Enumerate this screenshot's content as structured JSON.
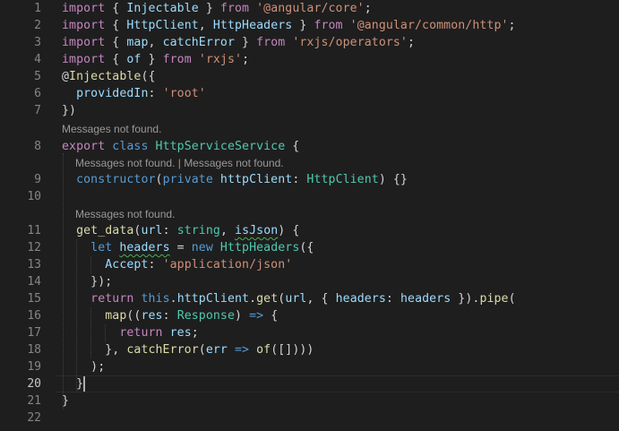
{
  "editor": {
    "codelens_text": "Messages not found.",
    "codelens_pair": "Messages not found. | Messages not found.",
    "lines": [
      {
        "n": "1",
        "seg": [
          [
            "kw2",
            "import"
          ],
          [
            "plain",
            " { "
          ],
          [
            "var",
            "Injectable"
          ],
          [
            "plain",
            " } "
          ],
          [
            "kw2",
            "from"
          ],
          [
            "plain",
            " "
          ],
          [
            "str",
            "'@angular/core'"
          ],
          [
            "plain",
            ";"
          ]
        ]
      },
      {
        "n": "2",
        "seg": [
          [
            "kw2",
            "import"
          ],
          [
            "plain",
            " { "
          ],
          [
            "var",
            "HttpClient"
          ],
          [
            "plain",
            ", "
          ],
          [
            "var",
            "HttpHeaders"
          ],
          [
            "plain",
            " } "
          ],
          [
            "kw2",
            "from"
          ],
          [
            "plain",
            " "
          ],
          [
            "str",
            "'@angular/common/http'"
          ],
          [
            "plain",
            ";"
          ]
        ]
      },
      {
        "n": "3",
        "seg": [
          [
            "kw2",
            "import"
          ],
          [
            "plain",
            " { "
          ],
          [
            "var",
            "map"
          ],
          [
            "plain",
            ", "
          ],
          [
            "var",
            "catchError"
          ],
          [
            "plain",
            " } "
          ],
          [
            "kw2",
            "from"
          ],
          [
            "plain",
            " "
          ],
          [
            "str",
            "'rxjs/operators'"
          ],
          [
            "plain",
            ";"
          ]
        ]
      },
      {
        "n": "4",
        "seg": [
          [
            "kw2",
            "import"
          ],
          [
            "plain",
            " { "
          ],
          [
            "var",
            "of"
          ],
          [
            "plain",
            " } "
          ],
          [
            "kw2",
            "from"
          ],
          [
            "plain",
            " "
          ],
          [
            "str",
            "'rxjs'"
          ],
          [
            "plain",
            ";"
          ]
        ]
      },
      {
        "n": "5",
        "seg": [
          [
            "plain",
            "@"
          ],
          [
            "dec",
            "Injectable"
          ],
          [
            "plain",
            "({"
          ]
        ]
      },
      {
        "n": "6",
        "seg": [
          [
            "plain",
            "  "
          ],
          [
            "var",
            "providedIn"
          ],
          [
            "plain",
            ": "
          ],
          [
            "str",
            "'root'"
          ]
        ]
      },
      {
        "n": "7",
        "seg": [
          [
            "plain",
            "})"
          ]
        ]
      },
      {
        "n": "8",
        "seg": [
          [
            "kw2",
            "export"
          ],
          [
            "plain",
            " "
          ],
          [
            "kw",
            "class"
          ],
          [
            "plain",
            " "
          ],
          [
            "cls",
            "HttpServiceService"
          ],
          [
            "plain",
            " {"
          ]
        ]
      },
      {
        "n": "9",
        "seg": [
          [
            "plain",
            "  "
          ],
          [
            "kw",
            "constructor"
          ],
          [
            "plain",
            "("
          ],
          [
            "kw",
            "private"
          ],
          [
            "plain",
            " "
          ],
          [
            "var",
            "httpClient"
          ],
          [
            "plain",
            ": "
          ],
          [
            "cls",
            "HttpClient"
          ],
          [
            "plain",
            ") {}"
          ]
        ]
      },
      {
        "n": "10",
        "seg": []
      },
      {
        "n": "11",
        "seg": [
          [
            "plain",
            "  "
          ],
          [
            "fn",
            "get_data"
          ],
          [
            "plain",
            "("
          ],
          [
            "var",
            "url"
          ],
          [
            "plain",
            ": "
          ],
          [
            "cls",
            "string"
          ],
          [
            "plain",
            ", "
          ],
          [
            "var",
            "isJson"
          ],
          [
            "plain",
            ") {"
          ]
        ]
      },
      {
        "n": "12",
        "seg": [
          [
            "plain",
            "    "
          ],
          [
            "kw",
            "let"
          ],
          [
            "plain",
            " "
          ],
          [
            "var",
            "headers"
          ],
          [
            "plain",
            " = "
          ],
          [
            "kw",
            "new"
          ],
          [
            "plain",
            " "
          ],
          [
            "cls",
            "HttpHeaders"
          ],
          [
            "plain",
            "({"
          ]
        ]
      },
      {
        "n": "13",
        "seg": [
          [
            "plain",
            "      "
          ],
          [
            "var",
            "Accept"
          ],
          [
            "plain",
            ": "
          ],
          [
            "str",
            "'application/json'"
          ]
        ]
      },
      {
        "n": "14",
        "seg": [
          [
            "plain",
            "    });"
          ]
        ]
      },
      {
        "n": "15",
        "seg": [
          [
            "plain",
            "    "
          ],
          [
            "kw2",
            "return"
          ],
          [
            "plain",
            " "
          ],
          [
            "kw",
            "this"
          ],
          [
            "plain",
            "."
          ],
          [
            "var",
            "httpClient"
          ],
          [
            "plain",
            "."
          ],
          [
            "fn",
            "get"
          ],
          [
            "plain",
            "("
          ],
          [
            "var",
            "url"
          ],
          [
            "plain",
            ", { "
          ],
          [
            "var",
            "headers"
          ],
          [
            "plain",
            ": "
          ],
          [
            "var",
            "headers"
          ],
          [
            "plain",
            " })."
          ],
          [
            "fn",
            "pipe"
          ],
          [
            "plain",
            "("
          ]
        ]
      },
      {
        "n": "16",
        "seg": [
          [
            "plain",
            "      "
          ],
          [
            "fn",
            "map"
          ],
          [
            "plain",
            "(("
          ],
          [
            "var",
            "res"
          ],
          [
            "plain",
            ": "
          ],
          [
            "cls",
            "Response"
          ],
          [
            "plain",
            ") "
          ],
          [
            "kw",
            "=>"
          ],
          [
            "plain",
            " {"
          ]
        ]
      },
      {
        "n": "17",
        "seg": [
          [
            "plain",
            "        "
          ],
          [
            "kw2",
            "return"
          ],
          [
            "plain",
            " "
          ],
          [
            "var",
            "res"
          ],
          [
            "plain",
            ";"
          ]
        ]
      },
      {
        "n": "18",
        "seg": [
          [
            "plain",
            "      }, "
          ],
          [
            "fn",
            "catchError"
          ],
          [
            "plain",
            "("
          ],
          [
            "var",
            "err"
          ],
          [
            "plain",
            " "
          ],
          [
            "kw",
            "=>"
          ],
          [
            "plain",
            " "
          ],
          [
            "fn",
            "of"
          ],
          [
            "plain",
            "([])))"
          ]
        ]
      },
      {
        "n": "19",
        "seg": [
          [
            "plain",
            "    );"
          ]
        ]
      },
      {
        "n": "20",
        "seg": [
          [
            "plain",
            "  }"
          ]
        ]
      },
      {
        "n": "21",
        "seg": [
          [
            "plain",
            "}"
          ]
        ]
      },
      {
        "n": "22",
        "seg": []
      }
    ]
  },
  "colors": {
    "background": "#1e1e1e",
    "keyword_blue": "#569cd6",
    "keyword_purple": "#c586c0",
    "string": "#ce9178",
    "type": "#4ec9b0",
    "variable": "#9cdcfe",
    "function": "#dcdcaa",
    "line_number": "#858585"
  }
}
